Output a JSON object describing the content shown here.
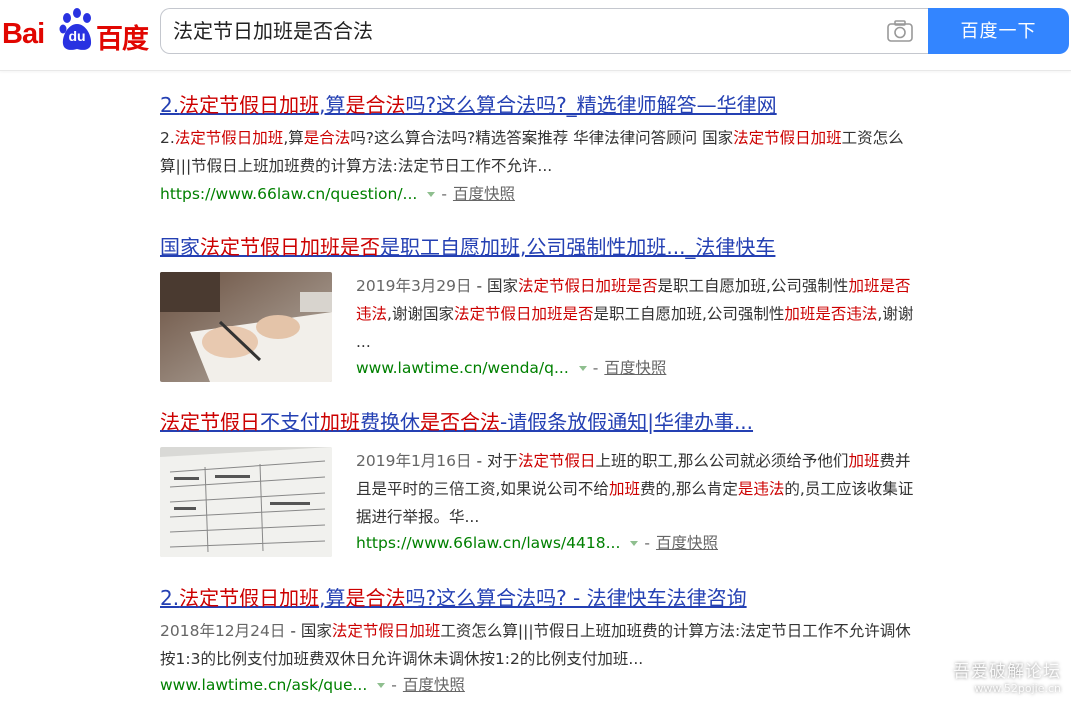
{
  "header": {
    "logo_bai": "Bai",
    "logo_du": "du",
    "logo_cn": "百度",
    "search_query": "法定节日加班是否合法",
    "search_button": "百度一下"
  },
  "results": [
    {
      "title_parts": [
        {
          "t": "2.",
          "hl": false
        },
        {
          "t": "法定节假日加班",
          "hl": true
        },
        {
          "t": ",算",
          "hl": false
        },
        {
          "t": "是合法",
          "hl": true
        },
        {
          "t": "吗?这么算合法吗?_精选律师解答—华律网",
          "hl": false
        }
      ],
      "abstract_parts": [
        {
          "t": "2.",
          "hl": false
        },
        {
          "t": "法定节假日加班",
          "hl": true
        },
        {
          "t": ",算",
          "hl": false
        },
        {
          "t": "是合法",
          "hl": true
        },
        {
          "t": "吗?这么算合法吗?精选答案推荐 华律法律问答顾问 国家",
          "hl": false
        },
        {
          "t": "法定节假日加班",
          "hl": true
        },
        {
          "t": "工资怎么算|||节假日上班加班费的计算方法:法定节日工作不允许...",
          "hl": false
        }
      ],
      "url": "https://www.66law.cn/question/...",
      "snapshot": "百度快照"
    },
    {
      "title_parts": [
        {
          "t": "国家",
          "hl": false
        },
        {
          "t": "法定节假日加班是否",
          "hl": true
        },
        {
          "t": "是职工自愿加班,公司强制性加班..._法律快车",
          "hl": false
        }
      ],
      "date": "2019年3月29日",
      "abstract_parts": [
        {
          "t": " - 国家",
          "hl": false
        },
        {
          "t": "法定节假日加班是否",
          "hl": true
        },
        {
          "t": "是职工自愿加班,公司强制性",
          "hl": false
        },
        {
          "t": "加班是否违法",
          "hl": true
        },
        {
          "t": ",谢谢国家",
          "hl": false
        },
        {
          "t": "法定节假日加班是否",
          "hl": true
        },
        {
          "t": "是职工自愿加班,公司强制性",
          "hl": false
        },
        {
          "t": "加班是否违法",
          "hl": true
        },
        {
          "t": ",谢谢 ...",
          "hl": false
        }
      ],
      "url": "www.lawtime.cn/wenda/q...",
      "snapshot": "百度快照"
    },
    {
      "title_parts": [
        {
          "t": "法定节假日",
          "hl": true
        },
        {
          "t": "不支付",
          "hl": false
        },
        {
          "t": "加班",
          "hl": true
        },
        {
          "t": "费换休",
          "hl": false
        },
        {
          "t": "是否合法",
          "hl": true
        },
        {
          "t": "-请假条放假通知|华律办事...",
          "hl": false
        }
      ],
      "date": "2019年1月16日",
      "abstract_parts": [
        {
          "t": " - 对于",
          "hl": false
        },
        {
          "t": "法定节假日",
          "hl": true
        },
        {
          "t": "上班的职工,那么公司就必须给予他们",
          "hl": false
        },
        {
          "t": "加班",
          "hl": true
        },
        {
          "t": "费并且是平时的三倍工资,如果说公司不给",
          "hl": false
        },
        {
          "t": "加班",
          "hl": true
        },
        {
          "t": "费的,那么肯定",
          "hl": false
        },
        {
          "t": "是违法",
          "hl": true
        },
        {
          "t": "的,员工应该收集证据进行举报。华...",
          "hl": false
        }
      ],
      "url": "https://www.66law.cn/laws/4418...",
      "snapshot": "百度快照"
    },
    {
      "title_parts": [
        {
          "t": "2.",
          "hl": false
        },
        {
          "t": "法定节假日加班",
          "hl": true
        },
        {
          "t": ",算",
          "hl": false
        },
        {
          "t": "是合法",
          "hl": true
        },
        {
          "t": "吗?这么算合法吗? - 法律快车法律咨询",
          "hl": false
        }
      ],
      "date": "2018年12月24日",
      "abstract_parts": [
        {
          "t": " - 国家",
          "hl": false
        },
        {
          "t": "法定节假日加班",
          "hl": true
        },
        {
          "t": "工资怎么算|||节假日上班加班费的计算方法:法定节日工作不允许调休按1:3的比例支付加班费双休日允许调休未调休按1:2的比例支付加班...",
          "hl": false
        }
      ],
      "url": "www.lawtime.cn/ask/que...",
      "snapshot": "百度快照"
    }
  ],
  "watermark": {
    "line1": "吾爱破解论坛",
    "line2": "www.52pojie.cn"
  },
  "colors": {
    "link": "#2440b3",
    "highlight": "#c00000",
    "url_green": "#008000",
    "button": "#3385ff"
  }
}
